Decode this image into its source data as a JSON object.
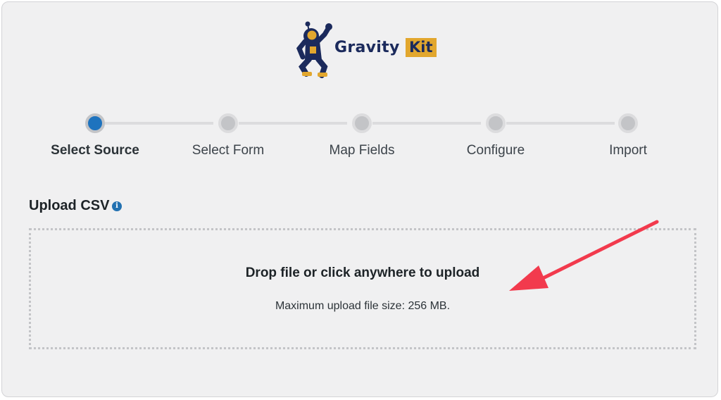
{
  "brand": {
    "name": "Gravity",
    "name_suffix": "Kit",
    "logo_icon": "astronaut-icon",
    "colors": {
      "navy": "#1b2a5c",
      "gold": "#e2a72e"
    }
  },
  "steps": [
    {
      "label": "Select Source",
      "state": "active"
    },
    {
      "label": "Select Form",
      "state": "pending"
    },
    {
      "label": "Map Fields",
      "state": "pending"
    },
    {
      "label": "Configure",
      "state": "pending"
    },
    {
      "label": "Import",
      "state": "pending"
    }
  ],
  "upload": {
    "title": "Upload CSV",
    "info_icon": "info-icon",
    "dropzone_title": "Drop file or click anywhere to upload",
    "dropzone_subtitle": "Maximum upload file size: 256 MB."
  },
  "annotation": {
    "icon": "red-arrow-icon",
    "color": "#f23a4d"
  },
  "colors": {
    "accent": "#1e73be",
    "background": "#f0f0f1"
  }
}
